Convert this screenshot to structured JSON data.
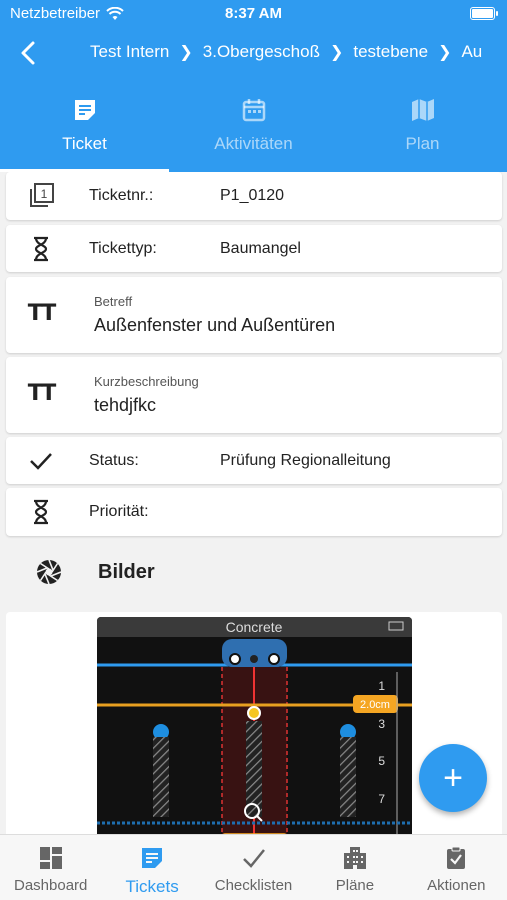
{
  "status_bar": {
    "carrier": "Netzbetreiber",
    "time": "8:37 AM"
  },
  "breadcrumb": [
    "Test Intern",
    "3.Obergeschoß",
    "testebene",
    "Au"
  ],
  "tabs": [
    {
      "label": "Ticket",
      "active": true,
      "icon": "note-icon"
    },
    {
      "label": "Aktivitäten",
      "active": false,
      "icon": "calendar-icon"
    },
    {
      "label": "Plan",
      "active": false,
      "icon": "map-icon"
    }
  ],
  "fields": {
    "ticketnr": {
      "label": "Ticketnr.:",
      "value": "P1_0120"
    },
    "tickettyp": {
      "label": "Tickettyp:",
      "value": "Baumangel"
    },
    "betreff": {
      "label": "Betreff",
      "value": "Außenfenster und Außentüren"
    },
    "kurzbeschreibung": {
      "label": "Kurzbeschreibung",
      "value": "tehdjfkc"
    },
    "status": {
      "label": "Status:",
      "value": "Prüfung Regionalleitung"
    },
    "prioritaet": {
      "label": "Priorität:",
      "value": ""
    }
  },
  "images_section": {
    "title": "Bilder"
  },
  "scanner_image": {
    "material": "Concrete",
    "depth_label": "2.0cm",
    "ticks": [
      "1",
      "3",
      "5",
      "7"
    ]
  },
  "fab": {
    "label": "+"
  },
  "bottom_nav": [
    {
      "label": "Dashboard",
      "active": false,
      "icon": "dashboard-icon"
    },
    {
      "label": "Tickets",
      "active": true,
      "icon": "tickets-icon"
    },
    {
      "label": "Checklisten",
      "active": false,
      "icon": "check-icon"
    },
    {
      "label": "Pläne",
      "active": false,
      "icon": "building-icon"
    },
    {
      "label": "Aktionen",
      "active": false,
      "icon": "clipboard-check-icon"
    }
  ],
  "colors": {
    "primary": "#2f9bf0",
    "background": "#f2f2f2"
  }
}
